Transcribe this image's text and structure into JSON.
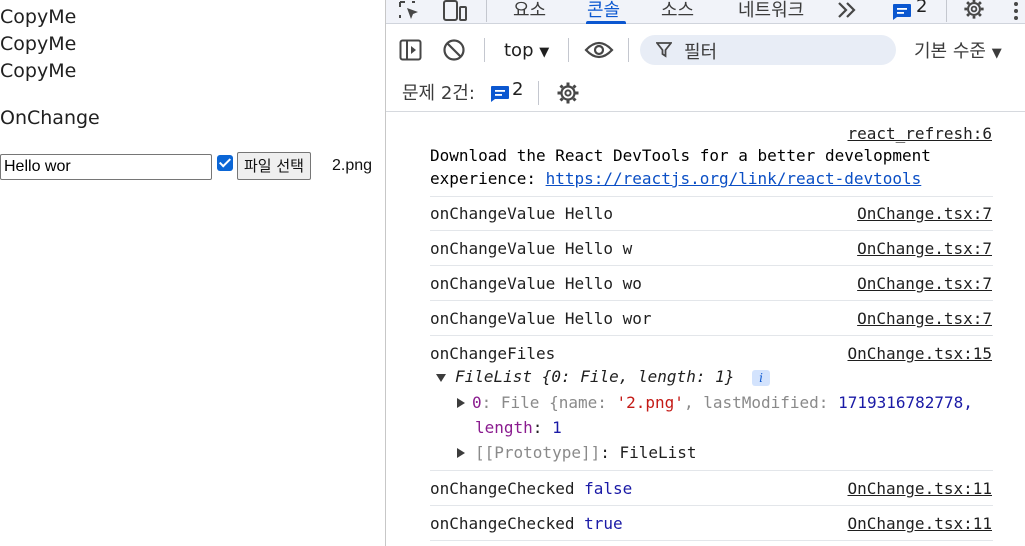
{
  "page": {
    "copy_lines": [
      "CopyMe",
      "CopyMe",
      "CopyMe"
    ],
    "onchange_title": "OnChange",
    "text_input_value": "Hello wor",
    "checkbox_checked": true,
    "file_button_label": "파일 선택",
    "file_name": "2.png"
  },
  "devtools": {
    "tabs": [
      {
        "label": "요소",
        "active": false
      },
      {
        "label": "콘솔",
        "active": true
      },
      {
        "label": "소스",
        "active": false
      },
      {
        "label": "네트워크",
        "active": false
      }
    ],
    "more_tabs_icon": "double-chevron-right-icon",
    "issues_badge_count": "2",
    "toolbar": {
      "context": "top",
      "filter_placeholder": "필터",
      "level": "기본 수준"
    },
    "issues": {
      "label": "문제 2건:",
      "count": "2"
    },
    "accent_color": "#0b57d0",
    "console": {
      "react_refresh": {
        "source": "react_refresh:6",
        "line1": "Download the React DevTools for a better development",
        "line2_prefix": "experience: ",
        "link": "https://reactjs.org/link/react-devtools"
      },
      "change_values": [
        {
          "text": "onChangeValue Hello",
          "source": "OnChange.tsx:7"
        },
        {
          "text": "onChangeValue Hello w",
          "source": "OnChange.tsx:7"
        },
        {
          "text": "onChangeValue Hello wo",
          "source": "OnChange.tsx:7"
        },
        {
          "text": "onChangeValue Hello wor",
          "source": "OnChange.tsx:7"
        }
      ],
      "files": {
        "text": "onChangeFiles",
        "source": "OnChange.tsx:15",
        "filelist_summary": "FileList {0: File, length: 1}",
        "item_key": "0",
        "item_type": "File",
        "item_name_key": "name",
        "item_name_value": "'2.png'",
        "item_lastmod_key": "lastModified",
        "item_lastmod_value": "1719316782778,",
        "length_key": "length",
        "length_value": "1",
        "prototype_key": "[[Prototype]]",
        "prototype_value": "FileList"
      },
      "checked": [
        {
          "label": "onChangeChecked",
          "value": "false",
          "source": "OnChange.tsx:11"
        },
        {
          "label": "onChangeChecked",
          "value": "true",
          "source": "OnChange.tsx:11"
        }
      ]
    }
  }
}
